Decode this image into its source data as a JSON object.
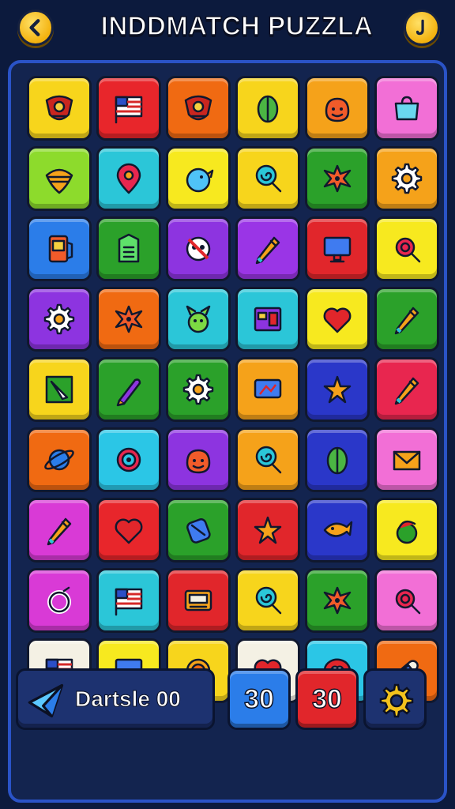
{
  "header": {
    "title": "INDDMATCH PUZZLA",
    "back_icon": "chevron-left-icon",
    "hint_icon": "hint-icon"
  },
  "board": {
    "tiles": [
      {
        "color": "#f7d51c",
        "icon": "crest-icon"
      },
      {
        "color": "#e8262b",
        "icon": "flag-icon"
      },
      {
        "color": "#f06a12",
        "icon": "crest-icon"
      },
      {
        "color": "#f7d51c",
        "icon": "leaf-icon"
      },
      {
        "color": "#f5a21a",
        "icon": "face-icon"
      },
      {
        "color": "#f26fd6",
        "icon": "bag-icon"
      },
      {
        "color": "#8ddb2c",
        "icon": "spinning-top-icon"
      },
      {
        "color": "#2bc6d8",
        "icon": "map-pin-icon"
      },
      {
        "color": "#f7e91f",
        "icon": "bird-icon"
      },
      {
        "color": "#f7d51c",
        "icon": "lollipop-icon"
      },
      {
        "color": "#2ba12a",
        "icon": "splat-icon"
      },
      {
        "color": "#f5a21a",
        "icon": "gear-icon"
      },
      {
        "color": "#2b7de9",
        "icon": "phone-icon"
      },
      {
        "color": "#2ba12a",
        "icon": "document-icon"
      },
      {
        "color": "#8d34e0",
        "icon": "skull-icon"
      },
      {
        "color": "#9a35e6",
        "icon": "pencil-icon"
      },
      {
        "color": "#e1262b",
        "icon": "monitor-icon"
      },
      {
        "color": "#f7e91f",
        "icon": "magnifier-icon"
      },
      {
        "color": "#8d34e0",
        "icon": "gear-icon"
      },
      {
        "color": "#f06a12",
        "icon": "splat-icon"
      },
      {
        "color": "#2bc6d8",
        "icon": "bunny-face-icon"
      },
      {
        "color": "#2bc6d8",
        "icon": "window-icon"
      },
      {
        "color": "#f7e91f",
        "icon": "heart-icon"
      },
      {
        "color": "#2ba12a",
        "icon": "pencil-icon"
      },
      {
        "color": "#f7d51c",
        "icon": "cursor-icon"
      },
      {
        "color": "#2ba12a",
        "icon": "crayon-icon"
      },
      {
        "color": "#2ba12a",
        "icon": "gear-icon"
      },
      {
        "color": "#f5a21a",
        "icon": "tv-icon"
      },
      {
        "color": "#2a37c9",
        "icon": "star-icon"
      },
      {
        "color": "#e8264f",
        "icon": "pencil-icon"
      },
      {
        "color": "#f06a12",
        "icon": "planet-icon"
      },
      {
        "color": "#2bc6e6",
        "icon": "target-icon"
      },
      {
        "color": "#8d34e0",
        "icon": "face-icon"
      },
      {
        "color": "#f5a21a",
        "icon": "lollipop-icon"
      },
      {
        "color": "#2a37c9",
        "icon": "leaf-icon"
      },
      {
        "color": "#f26fd6",
        "icon": "envelope-icon"
      },
      {
        "color": "#d93ad6",
        "icon": "pencil-icon"
      },
      {
        "color": "#e8262b",
        "icon": "heart-icon"
      },
      {
        "color": "#2ba12a",
        "icon": "canister-icon"
      },
      {
        "color": "#e1262b",
        "icon": "star-icon"
      },
      {
        "color": "#2a37c9",
        "icon": "fish-icon"
      },
      {
        "color": "#f7e91f",
        "icon": "apple-icon"
      },
      {
        "color": "#d93ad6",
        "icon": "ring-icon"
      },
      {
        "color": "#2bc6d8",
        "icon": "flag-icon"
      },
      {
        "color": "#e1262b",
        "icon": "radio-icon"
      },
      {
        "color": "#f7d51c",
        "icon": "lollipop-icon"
      },
      {
        "color": "#2ba12a",
        "icon": "splat-icon"
      },
      {
        "color": "#f26fd6",
        "icon": "magnifier-icon"
      },
      {
        "color": "#f4f1e4",
        "icon": "flag-icon"
      },
      {
        "color": "#f7e91f",
        "icon": "monitor-icon"
      },
      {
        "color": "#f7d51c",
        "icon": "sun-icon"
      },
      {
        "color": "#f4f1e4",
        "icon": "heart-icon"
      },
      {
        "color": "#2bc6e6",
        "icon": "chat-heart-icon"
      },
      {
        "color": "#f06a12",
        "icon": "bandage-icon"
      }
    ]
  },
  "footer": {
    "score_icon": "paper-plane-icon",
    "score_label": "Dartsle 00",
    "moves_value": "30",
    "time_value": "30",
    "settings_icon": "gear-icon"
  }
}
